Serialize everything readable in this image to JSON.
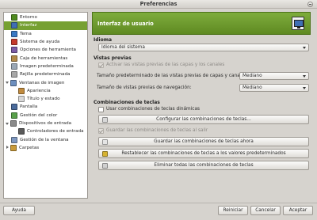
{
  "window": {
    "title": "Preferencias"
  },
  "tree": {
    "items": [
      {
        "label": "Entorno",
        "indent": 1,
        "icon_color": "#4e8a1e",
        "selected": false
      },
      {
        "label": "Interfaz",
        "indent": 1,
        "icon_color": "#3f6fb4",
        "selected": true
      },
      {
        "label": "Tema",
        "indent": 1,
        "icon_color": "#3a79c4",
        "selected": false
      },
      {
        "label": "Sistema de ayuda",
        "indent": 1,
        "icon_color": "#c43a2c",
        "selected": false
      },
      {
        "label": "Opciones de herramienta",
        "indent": 1,
        "icon_color": "#7b5ca6",
        "selected": false
      },
      {
        "label": "Caja de herramientas",
        "indent": 1,
        "icon_color": "#b28a4a",
        "selected": false
      },
      {
        "label": "Imagen predeterminada",
        "indent": 1,
        "icon_color": "#9aa7b5",
        "selected": false
      },
      {
        "label": "Rejilla predeterminada",
        "indent": 1,
        "icon_color": "#a8a8a8",
        "selected": false
      },
      {
        "label": "Ventanas de imagen",
        "indent": 0,
        "expander": "open",
        "icon_color": "#6d8fbe",
        "selected": false
      },
      {
        "label": "Apariencia",
        "indent": 2,
        "icon_color": "#c08a3e",
        "selected": false
      },
      {
        "label": "Título y estado",
        "indent": 2,
        "icon_color": "#d8d8d8",
        "selected": false
      },
      {
        "label": "Pantalla",
        "indent": 1,
        "icon_color": "#4a6b9c",
        "selected": false
      },
      {
        "label": "Gestión del color",
        "indent": 1,
        "icon_color": "#58a04a",
        "selected": false
      },
      {
        "label": "Dispositivos de entrada",
        "indent": 0,
        "expander": "open",
        "icon_color": "#8a8a8a",
        "selected": false
      },
      {
        "label": "Controladores de entrada",
        "indent": 2,
        "icon_color": "#5a5a5a",
        "selected": false
      },
      {
        "label": "Gestión de la ventana",
        "indent": 1,
        "icon_color": "#7e98c0",
        "selected": false
      },
      {
        "label": "Carpetas",
        "indent": 0,
        "expander": "closed",
        "icon_color": "#c89a3a",
        "selected": false
      }
    ]
  },
  "header": {
    "title": "Interfaz de usuario",
    "icon": "monitor-icon"
  },
  "idioma": {
    "heading": "Idioma",
    "value": "Idioma del sistema"
  },
  "previews": {
    "heading": "Vistas previas",
    "activate_label": "Activar las vistas previas de las capas y los canales",
    "activate_checked": true,
    "layer_size_label": "Tamaño predeterminado de las vistas previas de capas y canales:",
    "layer_size_value": "Mediano",
    "nav_size_label": "Tamaño de vistas previas de navegación:",
    "nav_size_value": "Mediano"
  },
  "shortcuts": {
    "heading": "Combinaciones de teclas",
    "dynamic_label": "Usar combinaciones de teclas dinámicas",
    "dynamic_checked": false,
    "configure_label": "Configurar las combinaciones de teclas...",
    "save_on_exit_label": "Guardar las combinaciones de teclas al salir",
    "save_on_exit_checked": true,
    "save_now_label": "Guardar las combinaciones de teclas ahora",
    "restore_label": "Restablecer las combinaciones de teclas a los valores predeterminados",
    "delete_label": "Eliminar todas las combinaciones de teclas"
  },
  "footer": {
    "help_label": "Ayuda",
    "reset_label": "Reiniciar",
    "cancel_label": "Cancelar",
    "accept_label": "Aceptar"
  }
}
